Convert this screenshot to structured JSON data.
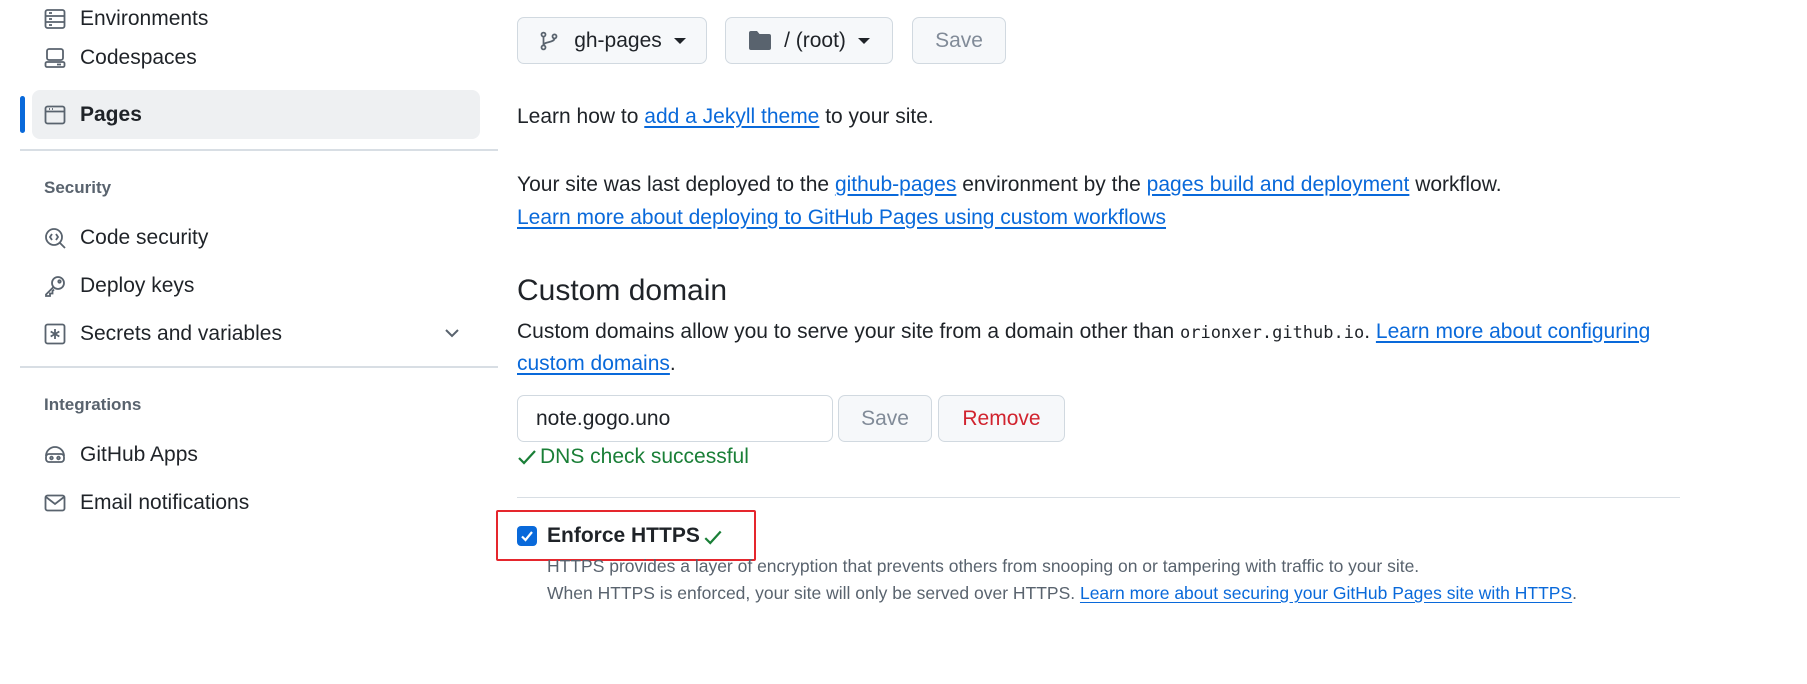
{
  "sidebar": {
    "items_top": [
      {
        "label": "Environments",
        "icon": "server-icon"
      },
      {
        "label": "Codespaces",
        "icon": "codespaces-icon"
      },
      {
        "label": "Pages",
        "icon": "browser-icon",
        "active": true
      }
    ],
    "security_title": "Security",
    "security_items": [
      {
        "label": "Code security",
        "icon": "codescan-icon"
      },
      {
        "label": "Deploy keys",
        "icon": "key-icon"
      },
      {
        "label": "Secrets and variables",
        "icon": "asterisk-icon"
      }
    ],
    "integrations_title": "Integrations",
    "integrations_items": [
      {
        "label": "GitHub Apps",
        "icon": "hubot-icon"
      },
      {
        "label": "Email notifications",
        "icon": "mail-icon"
      }
    ]
  },
  "source": {
    "branch": "gh-pages",
    "folder": "/ (root)",
    "save_label": "Save"
  },
  "jekyll": {
    "prefix": "Learn how to ",
    "link": "add a Jekyll theme",
    "suffix": " to your site."
  },
  "deploy": {
    "part1": "Your site was last deployed to the ",
    "env_link": "github-pages",
    "part2": " environment by the ",
    "workflow_link": "pages build and deployment",
    "part3": " workflow.",
    "learn_link": "Learn more about deploying to GitHub Pages using custom workflows"
  },
  "custom_domain": {
    "title": "Custom domain",
    "desc_prefix": "Custom domains allow you to serve your site from a domain other than ",
    "default_domain": "orionxer.github.io",
    "desc_dot": ".",
    "learn_link_1": "Learn more about configuring",
    "learn_link_2": "custom domains",
    "desc_end": ".",
    "value": "note.gogo.uno",
    "save_label": "Save",
    "remove_label": "Remove",
    "dns_status": "DNS check successful"
  },
  "https": {
    "label": "Enforce HTTPS",
    "checked": true,
    "desc1": "HTTPS provides a layer of encryption that prevents others from snooping on or tampering with traffic to your site.",
    "desc2_prefix": "When HTTPS is enforced, your site will only be served over HTTPS. ",
    "desc2_link": "Learn more about securing your GitHub Pages site with HTTPS",
    "desc2_end": "."
  },
  "colors": {
    "accent": "#0969da",
    "success": "#1a7f37",
    "danger": "#d1242f",
    "highlight": "#e5262d"
  }
}
